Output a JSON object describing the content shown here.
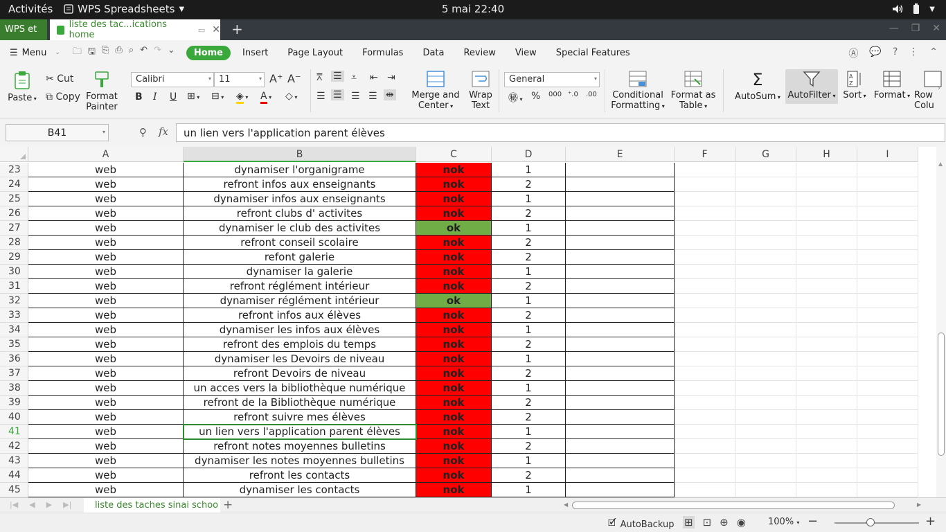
{
  "topbar": {
    "activities": "Activités",
    "app_name": "WPS Spreadsheets",
    "clock": "5 mai  22:40"
  },
  "tabs": {
    "home_tab": "WPS et",
    "doc_tab": "liste des tac...ications home"
  },
  "menu": {
    "menu_label": "Menu",
    "tabs": [
      "Home",
      "Insert",
      "Page Layout",
      "Formulas",
      "Data",
      "Review",
      "View",
      "Special Features"
    ],
    "active_tab": "Home"
  },
  "ribbon": {
    "paste": "Paste",
    "cut": "Cut",
    "copy": "Copy",
    "format_painter_1": "Format",
    "format_painter_2": "Painter",
    "font_name": "Calibri",
    "font_size": "11",
    "merge_1": "Merge and",
    "merge_2": "Center",
    "wrap_1": "Wrap",
    "wrap_2": "Text",
    "number_format": "General",
    "cond_1": "Conditional",
    "cond_2": "Formatting",
    "fmt_table_1": "Format as",
    "fmt_table_2": "Table",
    "autosum": "AutoSum",
    "autofilter": "AutoFilter",
    "sort": "Sort",
    "format": "Format",
    "row_col_1": "Row",
    "row_col_2": "Colu"
  },
  "formula_bar": {
    "name_box": "B41",
    "formula": "un lien vers l'application parent élèves"
  },
  "columns": [
    "A",
    "B",
    "C",
    "D",
    "E",
    "F",
    "G",
    "H",
    "I"
  ],
  "rows": [
    {
      "n": "23",
      "a": "web",
      "b": "dynamiser l'organigrame",
      "c": "nok",
      "d": "1"
    },
    {
      "n": "24",
      "a": "web",
      "b": "refront infos aux enseignants",
      "c": "nok",
      "d": "2"
    },
    {
      "n": "25",
      "a": "web",
      "b": "dynamiser  infos aux enseignants",
      "c": "nok",
      "d": "1"
    },
    {
      "n": "26",
      "a": "web",
      "b": "refront clubs d' activites",
      "c": "nok",
      "d": "2"
    },
    {
      "n": "27",
      "a": "web",
      "b": "dynamiser le club des activites",
      "c": "ok",
      "d": "1"
    },
    {
      "n": "28",
      "a": "web",
      "b": "refront conseil scolaire",
      "c": "nok",
      "d": "2"
    },
    {
      "n": "29",
      "a": "web",
      "b": "refont galerie",
      "c": "nok",
      "d": "2"
    },
    {
      "n": "30",
      "a": "web",
      "b": "dynamiser la galerie",
      "c": "nok",
      "d": "1"
    },
    {
      "n": "31",
      "a": "web",
      "b": "refront réglément intérieur",
      "c": "nok",
      "d": "2"
    },
    {
      "n": "32",
      "a": "web",
      "b": "dynamiser réglément intérieur",
      "c": "ok",
      "d": "1"
    },
    {
      "n": "33",
      "a": "web",
      "b": "refront infos aux élèves",
      "c": "nok",
      "d": "2"
    },
    {
      "n": "34",
      "a": "web",
      "b": "dynamiser les infos aux élèves",
      "c": "nok",
      "d": "1"
    },
    {
      "n": "35",
      "a": "web",
      "b": "refront des emplois du temps",
      "c": "nok",
      "d": "2"
    },
    {
      "n": "36",
      "a": "web",
      "b": "dynamiser les Devoirs de niveau",
      "c": "nok",
      "d": "1"
    },
    {
      "n": "37",
      "a": "web",
      "b": "refront Devoirs de niveau",
      "c": "nok",
      "d": "2"
    },
    {
      "n": "38",
      "a": "web",
      "b": "un acces vers la bibliothèque numérique",
      "c": "nok",
      "d": "1"
    },
    {
      "n": "39",
      "a": "web",
      "b": "refront de la Bibliothèque numérique",
      "c": "nok",
      "d": "2"
    },
    {
      "n": "40",
      "a": "web",
      "b": "refront suivre mes élèves",
      "c": "nok",
      "d": "2"
    },
    {
      "n": "41",
      "a": "web",
      "b": "un lien vers l'application parent élèves",
      "c": "nok",
      "d": "1"
    },
    {
      "n": "42",
      "a": "web",
      "b": "refront notes moyennes bulletins",
      "c": "nok",
      "d": "2"
    },
    {
      "n": "43",
      "a": "web",
      "b": "dynamiser les notes moyennes bulletins",
      "c": "nok",
      "d": "1"
    },
    {
      "n": "44",
      "a": "web",
      "b": "refront les contacts",
      "c": "nok",
      "d": "2"
    },
    {
      "n": "45",
      "a": "web",
      "b": "dynamiser les contacts",
      "c": "nok",
      "d": "1"
    }
  ],
  "active_cell": {
    "column": "B",
    "row": "41"
  },
  "status_colors": {
    "nok": "#ff0000",
    "ok": "#70ad47"
  },
  "sheet_tab": "liste des taches sinai schoo",
  "status": {
    "autobackup": "AutoBackup",
    "zoom": "100%"
  },
  "accent_color": "#3aa83a"
}
